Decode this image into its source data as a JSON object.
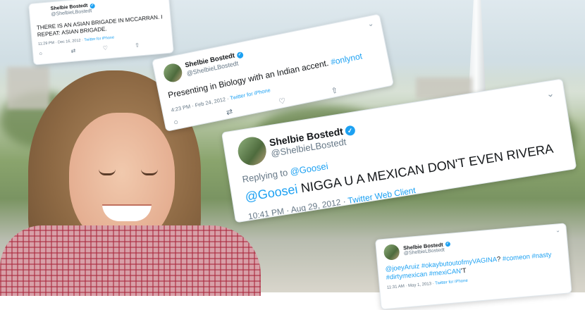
{
  "tweets": [
    {
      "name": "Shelbie Bostedt",
      "handle": "@ShelbieLBostedt",
      "text": "THERE IS AN ASIAN BRIGADE IN MCCARRAN. I REPEAT: ASIAN BRIGADE.",
      "time": "11:29 PM · Dec 16, 2012",
      "source": "Twitter for iPhone"
    },
    {
      "name": "Shelbie Bostedt",
      "handle": "@ShelbieLBostedt",
      "text": "Presenting in Biology with an Indian accent.",
      "hashtag": "#onlynot",
      "time": "4:23 PM · Feb 24, 2012",
      "source": "Twitter for iPhone"
    },
    {
      "name": "Shelbie Bostedt",
      "handle": "@ShelbieLBostedt",
      "reply_prefix": "Replying to",
      "reply_to": "@Goosei",
      "mention": "@Goosei",
      "text": "NIGGA U A MEXICAN DON'T EVEN RIVERA",
      "time": "10:41 PM · Aug 29, 2012",
      "source": "Twitter Web Client"
    },
    {
      "name": "Shelbie Bostedt",
      "handle": "@ShelbieLBostedt",
      "mention": "@joeyAruiz",
      "tag1": "#okaybutoutofmyVAGINA",
      "mid": "?",
      "tag2": "#comeon",
      "tag3": "#nasty",
      "tag4": "#dirtymexican",
      "tag5": "#mexiCAN",
      "tail": "'T",
      "time": "11:31 AM · May 1, 2013",
      "source": "Twitter for iPhone"
    }
  ],
  "icons": {
    "verified": "✓",
    "reply": "○",
    "retweet": "⇄",
    "like": "♡",
    "share": "⇧",
    "chevron": "⌄"
  },
  "colors": {
    "link": "#1da1f2",
    "muted": "#657786"
  }
}
